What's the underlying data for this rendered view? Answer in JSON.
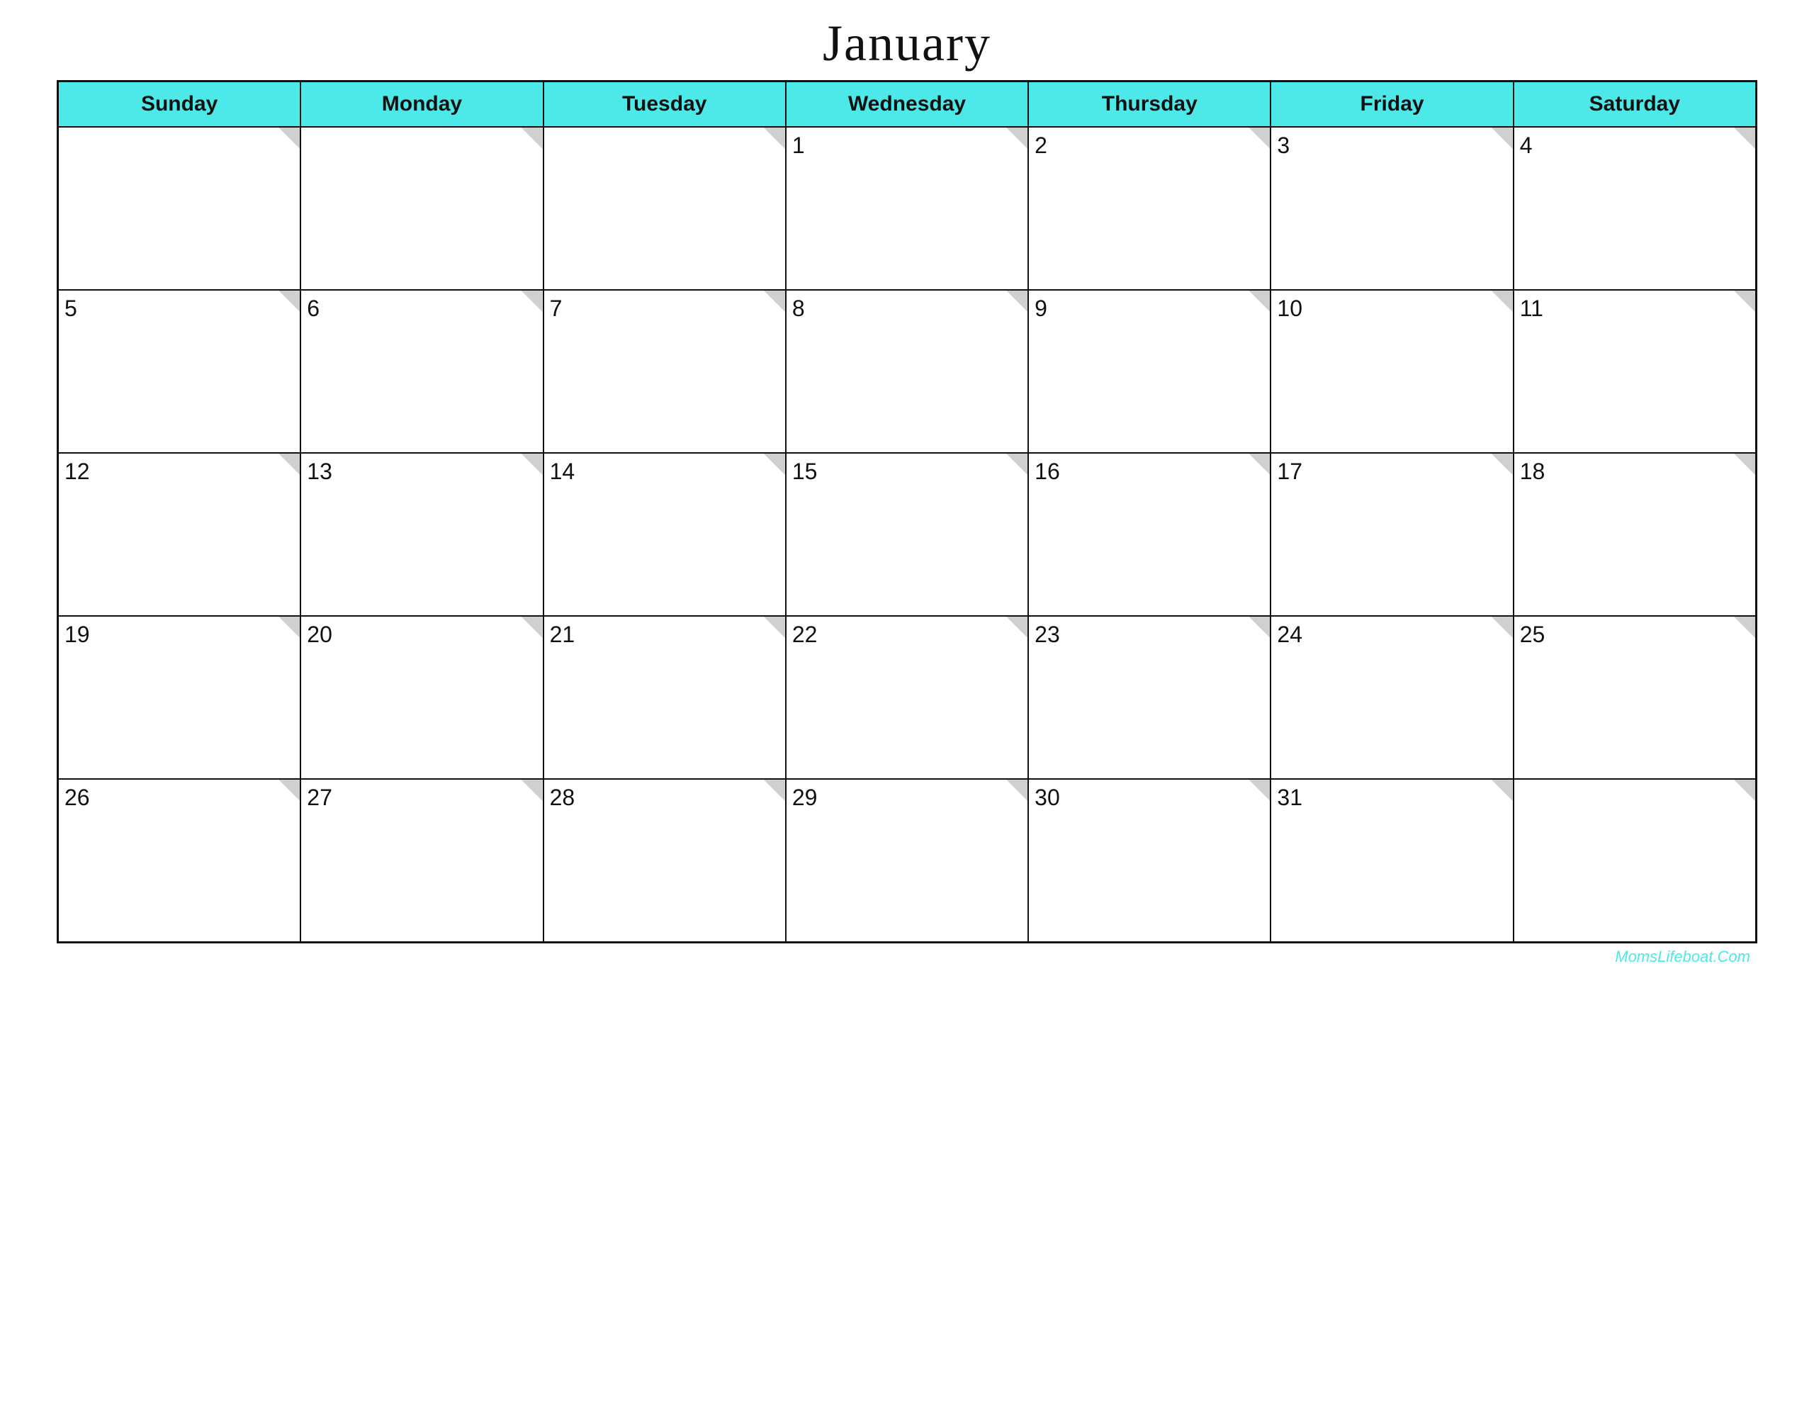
{
  "title": "January",
  "watermark": "MomsLifeboat.Com",
  "header": {
    "days": [
      "Sunday",
      "Monday",
      "Tuesday",
      "Wednesday",
      "Thursday",
      "Friday",
      "Saturday"
    ]
  },
  "calendar": {
    "weeks": [
      [
        {
          "day": "",
          "empty": true
        },
        {
          "day": "",
          "empty": true
        },
        {
          "day": "",
          "empty": true
        },
        {
          "day": "1",
          "empty": false
        },
        {
          "day": "2",
          "empty": false
        },
        {
          "day": "3",
          "empty": false
        },
        {
          "day": "4",
          "empty": false
        }
      ],
      [
        {
          "day": "5",
          "empty": false
        },
        {
          "day": "6",
          "empty": false
        },
        {
          "day": "7",
          "empty": false
        },
        {
          "day": "8",
          "empty": false
        },
        {
          "day": "9",
          "empty": false
        },
        {
          "day": "10",
          "empty": false
        },
        {
          "day": "11",
          "empty": false
        }
      ],
      [
        {
          "day": "12",
          "empty": false
        },
        {
          "day": "13",
          "empty": false
        },
        {
          "day": "14",
          "empty": false
        },
        {
          "day": "15",
          "empty": false
        },
        {
          "day": "16",
          "empty": false
        },
        {
          "day": "17",
          "empty": false
        },
        {
          "day": "18",
          "empty": false
        }
      ],
      [
        {
          "day": "19",
          "empty": false
        },
        {
          "day": "20",
          "empty": false
        },
        {
          "day": "21",
          "empty": false
        },
        {
          "day": "22",
          "empty": false
        },
        {
          "day": "23",
          "empty": false
        },
        {
          "day": "24",
          "empty": false
        },
        {
          "day": "25",
          "empty": false
        }
      ],
      [
        {
          "day": "26",
          "empty": false
        },
        {
          "day": "27",
          "empty": false
        },
        {
          "day": "28",
          "empty": false
        },
        {
          "day": "29",
          "empty": false
        },
        {
          "day": "30",
          "empty": false
        },
        {
          "day": "31",
          "empty": false
        },
        {
          "day": "",
          "empty": true
        }
      ]
    ]
  },
  "accent_color": "#4de8e8"
}
